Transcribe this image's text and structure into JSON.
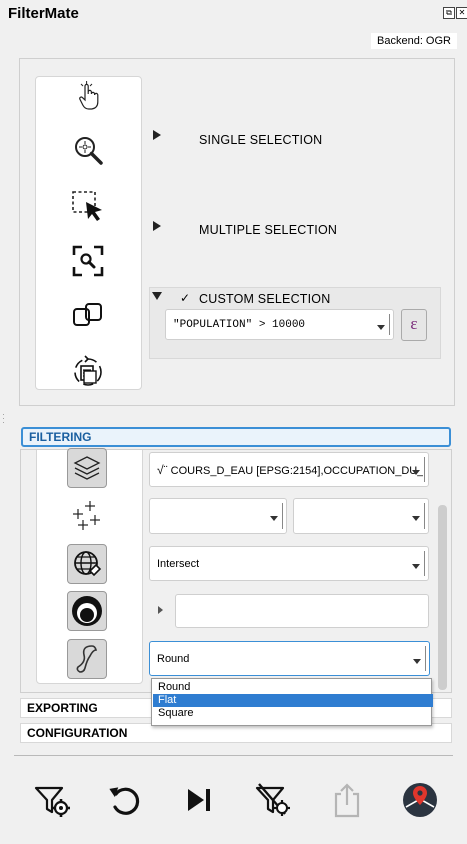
{
  "app": {
    "title": "FilterMate"
  },
  "window_buttons": {
    "float": "⧉",
    "close": "✕"
  },
  "backend": {
    "label": "Backend: OGR"
  },
  "selection": {
    "single": "SINGLE SELECTION",
    "multiple": "MULTIPLE SELECTION",
    "custom": "CUSTOM SELECTION",
    "custom_check": "✓",
    "expression_value": "\"POPULATION\" > 10000",
    "expression_button": "ε"
  },
  "sections": {
    "filtering": "FILTERING",
    "exporting": "EXPORTING",
    "configuration": "CONFIGURATION"
  },
  "filtering": {
    "layer_value": "COURS_D_EAU [EPSG:2154],OCCUPATION_DU_",
    "layer_prefix": "√¨",
    "combo_a_value": "",
    "combo_b_value": "",
    "predicate_value": "Intersect",
    "buffer_value": "",
    "cap_style_value": "Round",
    "cap_style_options": [
      "Round",
      "Flat",
      "Square"
    ],
    "cap_style_highlighted": "Flat"
  },
  "colors": {
    "accent": "#3b8fd6",
    "highlight": "#2f7dd1",
    "export_disabled": "#b5b5b5",
    "map_icon": "#2b3440",
    "pin": "#e0362c"
  }
}
